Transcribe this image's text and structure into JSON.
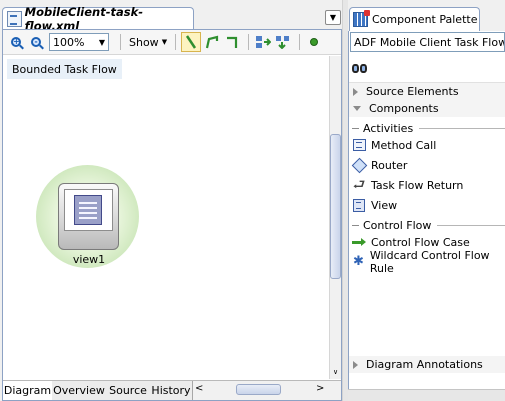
{
  "editor": {
    "tab_title": "MobileClient-task-flow.xml",
    "toolbar": {
      "zoom_value": "100%",
      "show_label": "Show"
    },
    "canvas": {
      "bounded_label": "Bounded Task Flow",
      "activity_label": "view1"
    },
    "bottom_tabs": [
      "Diagram",
      "Overview",
      "Source",
      "History"
    ]
  },
  "palette": {
    "tab_title": "Component Palette",
    "library_select": "ADF Mobile Client Task Flow",
    "sections": {
      "source_elements": "Source Elements",
      "components": "Components",
      "diagram_annotations": "Diagram Annotations"
    },
    "groups": {
      "activities": "Activities",
      "control_flow": "Control Flow"
    },
    "activities": [
      "Method Call",
      "Router",
      "Task Flow Return",
      "View"
    ],
    "control_flow_items": [
      "Control Flow Case",
      "Wildcard Control Flow Rule"
    ]
  },
  "icons": {
    "zoom_in": "zoom-in-icon",
    "zoom_out": "zoom-out-icon",
    "search": "binoculars-icon"
  },
  "colors": {
    "tab_border": "#8da2c4",
    "view_glow": "#b8dca2",
    "control_flow_arrow": "#3a9a2a"
  }
}
